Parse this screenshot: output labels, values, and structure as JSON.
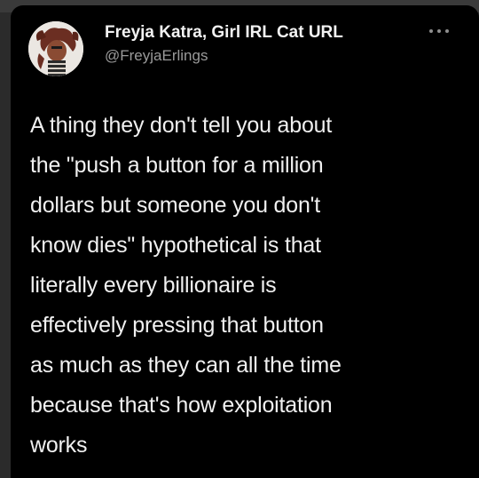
{
  "author": {
    "display_name": "Freyja Katra, Girl IRL Cat URL",
    "handle": "@FreyjaErlings",
    "avatar_icon": "illustrated-character-avatar"
  },
  "menu": {
    "icon": "more-options-icon"
  },
  "tweet": {
    "lines": [
      "A thing they don't tell you about",
      "the \"push a button for a million",
      "dollars but someone you don't",
      "know dies\" hypothetical is that",
      "literally every billionaire is",
      "effectively pressing that button",
      "as much as they can all the time",
      "because that's how exploitation",
      "works"
    ]
  },
  "colors": {
    "card_background": "#000000",
    "page_background": "#2b2b2b",
    "text_primary": "#f0f0f0",
    "text_secondary": "#9a9a9a"
  }
}
